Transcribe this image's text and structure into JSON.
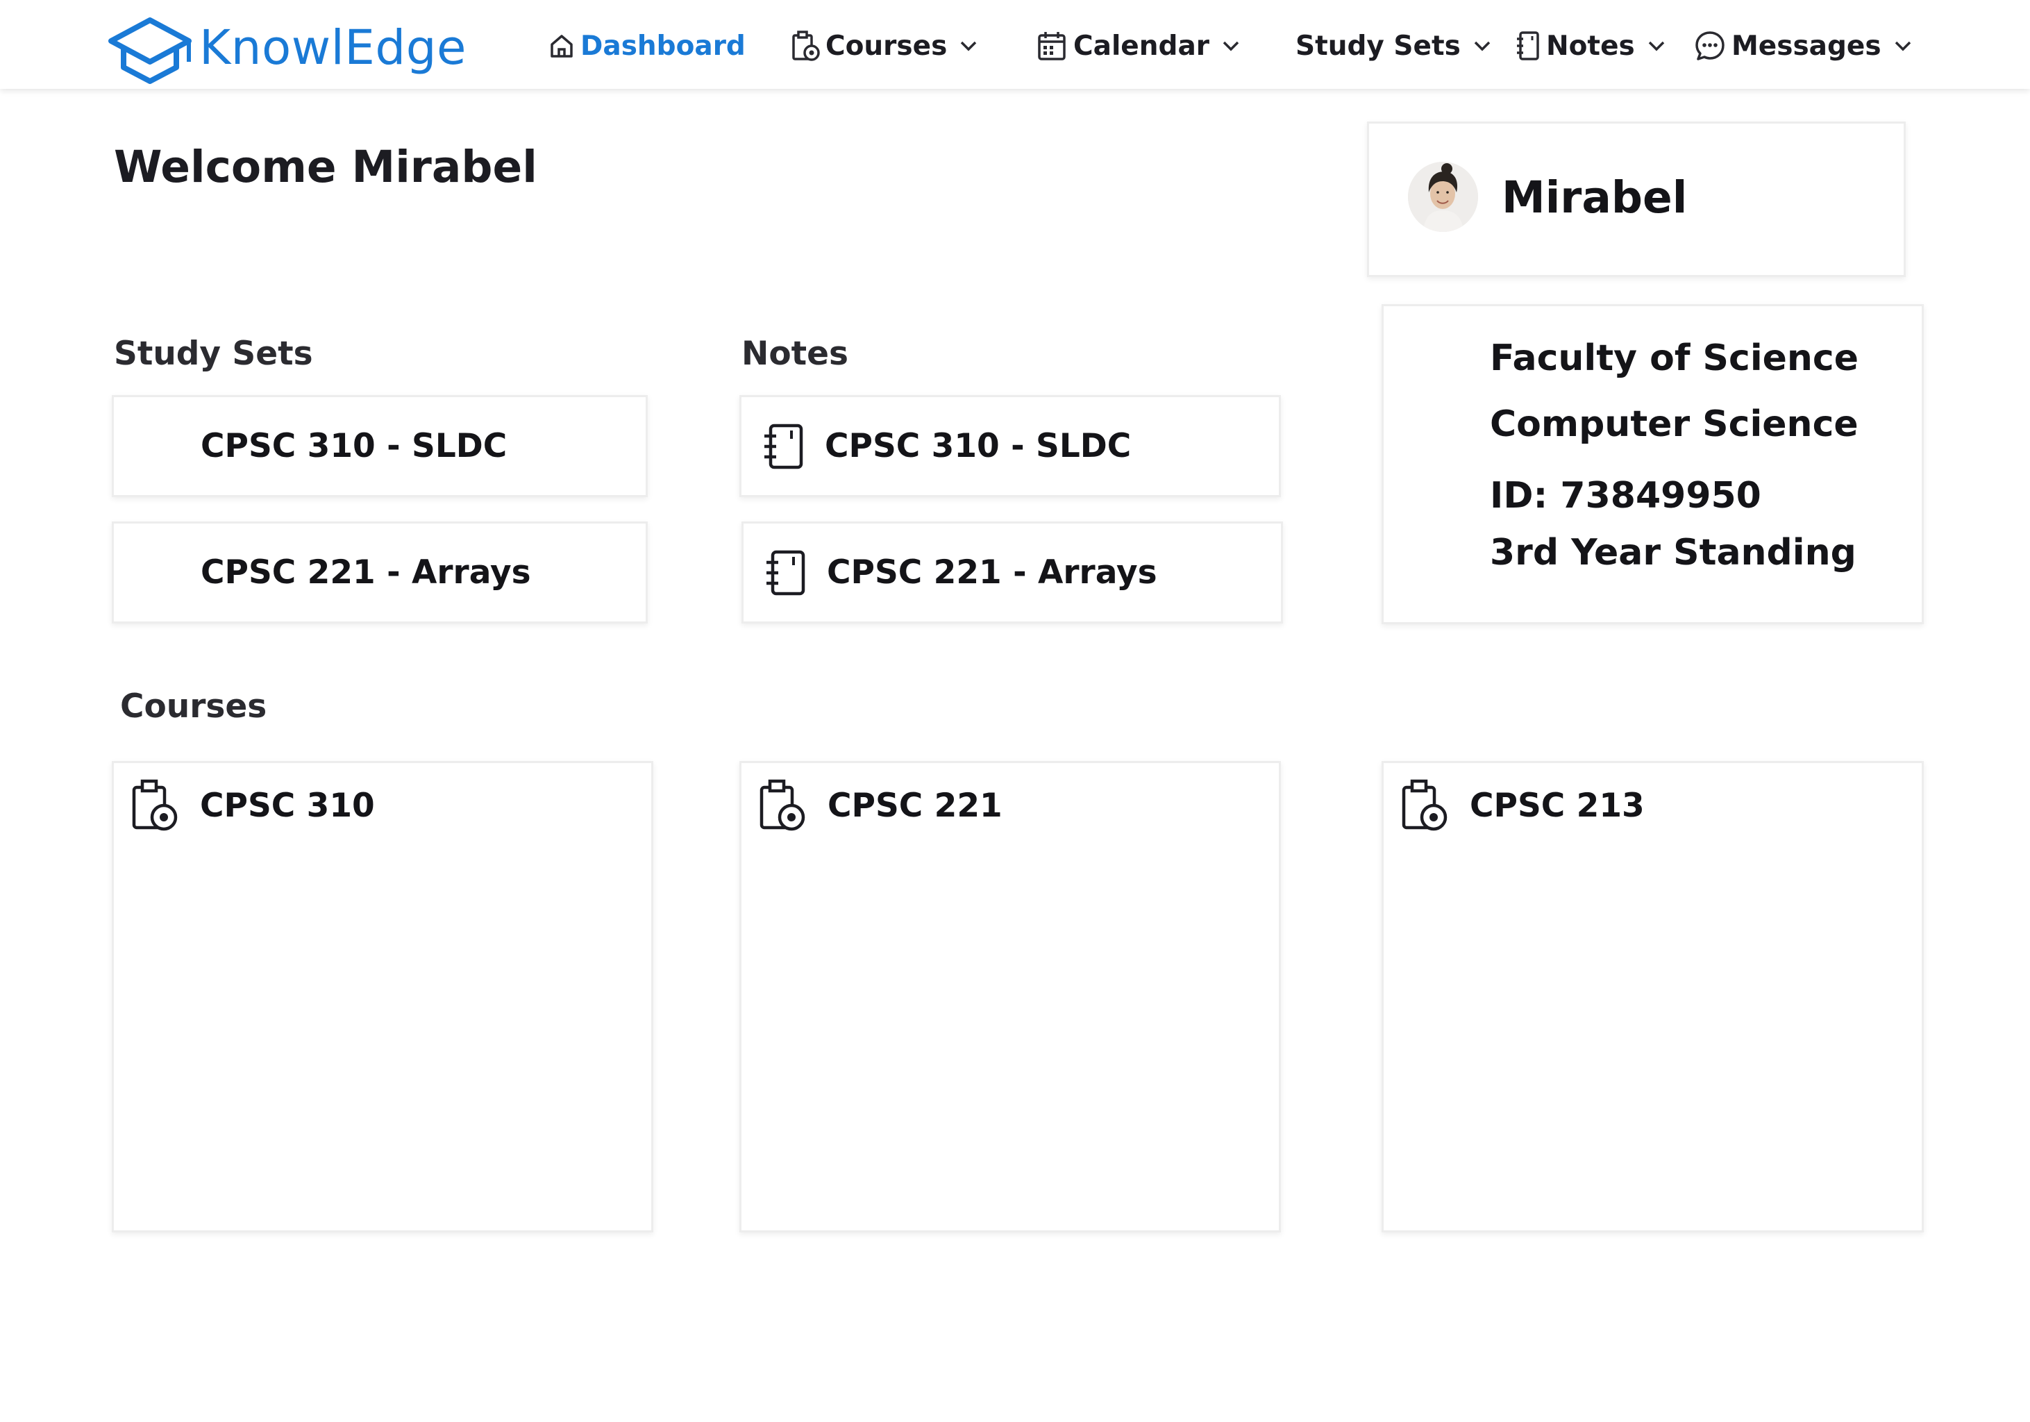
{
  "app": {
    "name": "KnowlEdge",
    "brand_color": "#1a7ad6"
  },
  "nav": {
    "items": [
      {
        "label": "Dashboard",
        "icon": "home-icon",
        "active": true,
        "has_dropdown": false
      },
      {
        "label": "Courses",
        "icon": "clipboard-icon",
        "active": false,
        "has_dropdown": true
      },
      {
        "label": "Calendar",
        "icon": "calendar-icon",
        "active": false,
        "has_dropdown": true
      },
      {
        "label": "Study Sets",
        "icon": "",
        "active": false,
        "has_dropdown": true
      },
      {
        "label": "Notes",
        "icon": "notebook-icon",
        "active": false,
        "has_dropdown": true
      },
      {
        "label": "Messages",
        "icon": "chat-icon",
        "active": false,
        "has_dropdown": true
      }
    ]
  },
  "welcome": {
    "text": "Welcome Mirabel"
  },
  "profile": {
    "name": "Mirabel",
    "faculty": "Faculty of Science",
    "program": "Computer Science",
    "id_line": "ID: 73849950",
    "standing": "3rd Year Standing"
  },
  "study_sets": {
    "title": "Study Sets",
    "items": [
      {
        "label": "CPSC 310 - SLDC"
      },
      {
        "label": "CPSC 221 - Arrays"
      }
    ]
  },
  "notes": {
    "title": "Notes",
    "items": [
      {
        "label": "CPSC 310 - SLDC",
        "icon": "notebook-icon"
      },
      {
        "label": "CPSC 221 - Arrays",
        "icon": "notebook-icon"
      }
    ]
  },
  "courses": {
    "title": "Courses",
    "items": [
      {
        "label": "CPSC 310",
        "icon": "clipboard-icon"
      },
      {
        "label": "CPSC 221",
        "icon": "clipboard-icon"
      },
      {
        "label": "CPSC 213",
        "icon": "clipboard-icon"
      }
    ]
  }
}
